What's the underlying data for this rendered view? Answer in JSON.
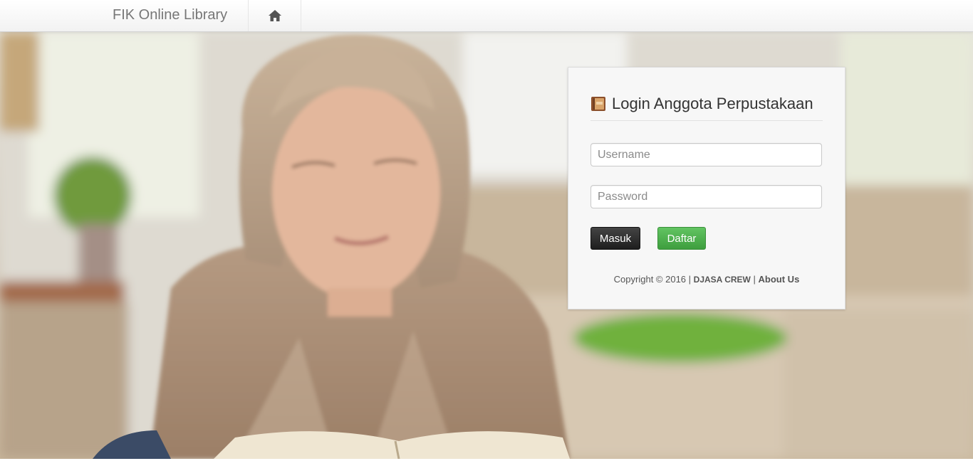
{
  "navbar": {
    "brand": "FIK Online Library",
    "home_icon": "home-icon"
  },
  "hero": {
    "image": "woman-reading-book-photo"
  },
  "login": {
    "title": "Login Anggota Perpustakaan",
    "title_icon": "book-icon",
    "username_placeholder": "Username",
    "password_placeholder": "Password",
    "login_button": "Masuk",
    "register_button": "Daftar",
    "copyright_prefix": "Copyright © 2016 |",
    "crew": "DJASA CREW",
    "separator": "|",
    "about": "About Us"
  },
  "colors": {
    "login_button": "#222222",
    "register_button": "#4cae4c",
    "panel_bg": "#f7f7f7"
  }
}
